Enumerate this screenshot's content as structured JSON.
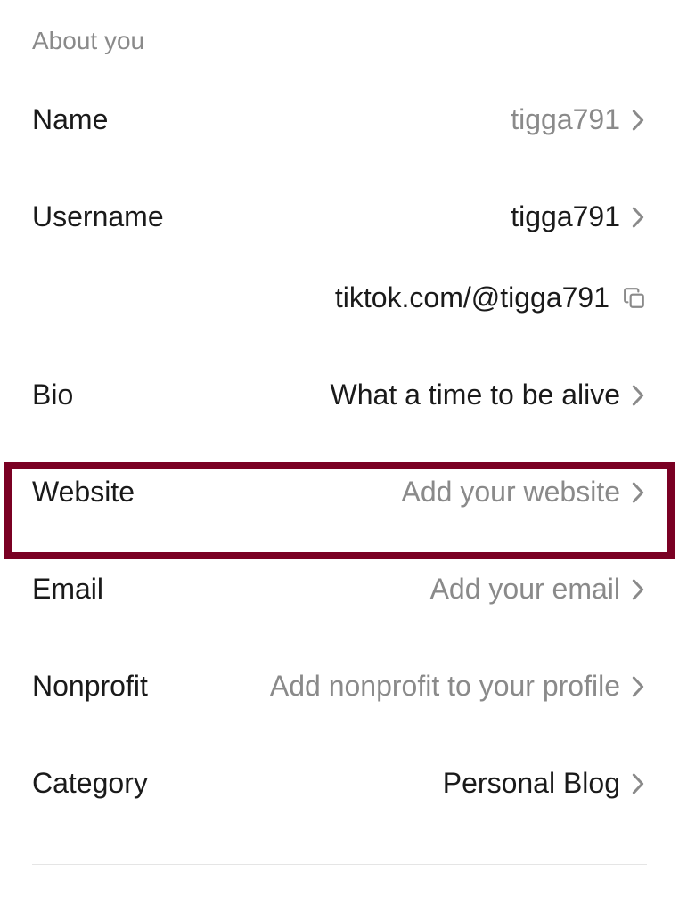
{
  "section": {
    "title": "About you"
  },
  "rows": {
    "name": {
      "label": "Name",
      "value": "tigga791"
    },
    "username": {
      "label": "Username",
      "value": "tigga791"
    },
    "profile_url": "tiktok.com/@tigga791",
    "bio": {
      "label": "Bio",
      "value": "What a time to be alive"
    },
    "website": {
      "label": "Website",
      "placeholder": "Add your website"
    },
    "email": {
      "label": "Email",
      "placeholder": "Add your email"
    },
    "nonprofit": {
      "label": "Nonprofit",
      "placeholder": "Add nonprofit to your profile"
    },
    "category": {
      "label": "Category",
      "value": "Personal Blog"
    }
  },
  "colors": {
    "highlight_border": "#7a0023"
  }
}
